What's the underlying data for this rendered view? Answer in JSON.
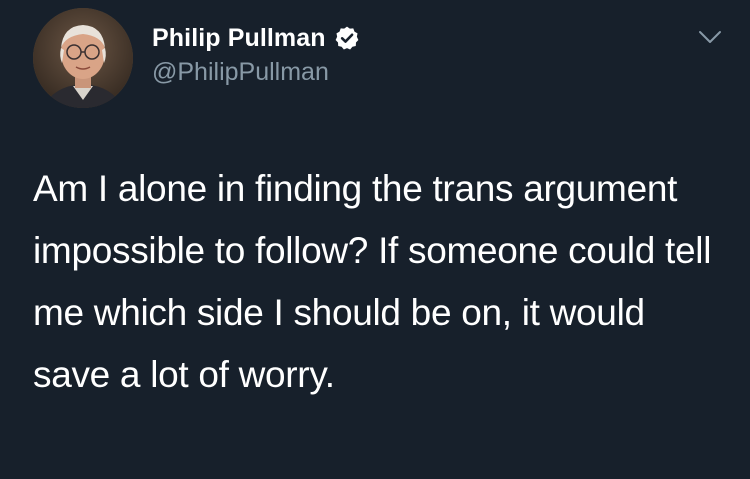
{
  "author": {
    "display_name": "Philip Pullman",
    "handle": "@PhilipPullman",
    "verified": true
  },
  "icons": {
    "verified": "verified-badge-icon",
    "menu": "chevron-down-icon"
  },
  "tweet": {
    "text": "Am I alone in finding the trans argument impossible to follow? If someone could tell me which side I should be on, it would save a lot of worry."
  },
  "colors": {
    "background": "#17202b",
    "text": "#ffffff",
    "secondary_text": "#8899a6"
  }
}
